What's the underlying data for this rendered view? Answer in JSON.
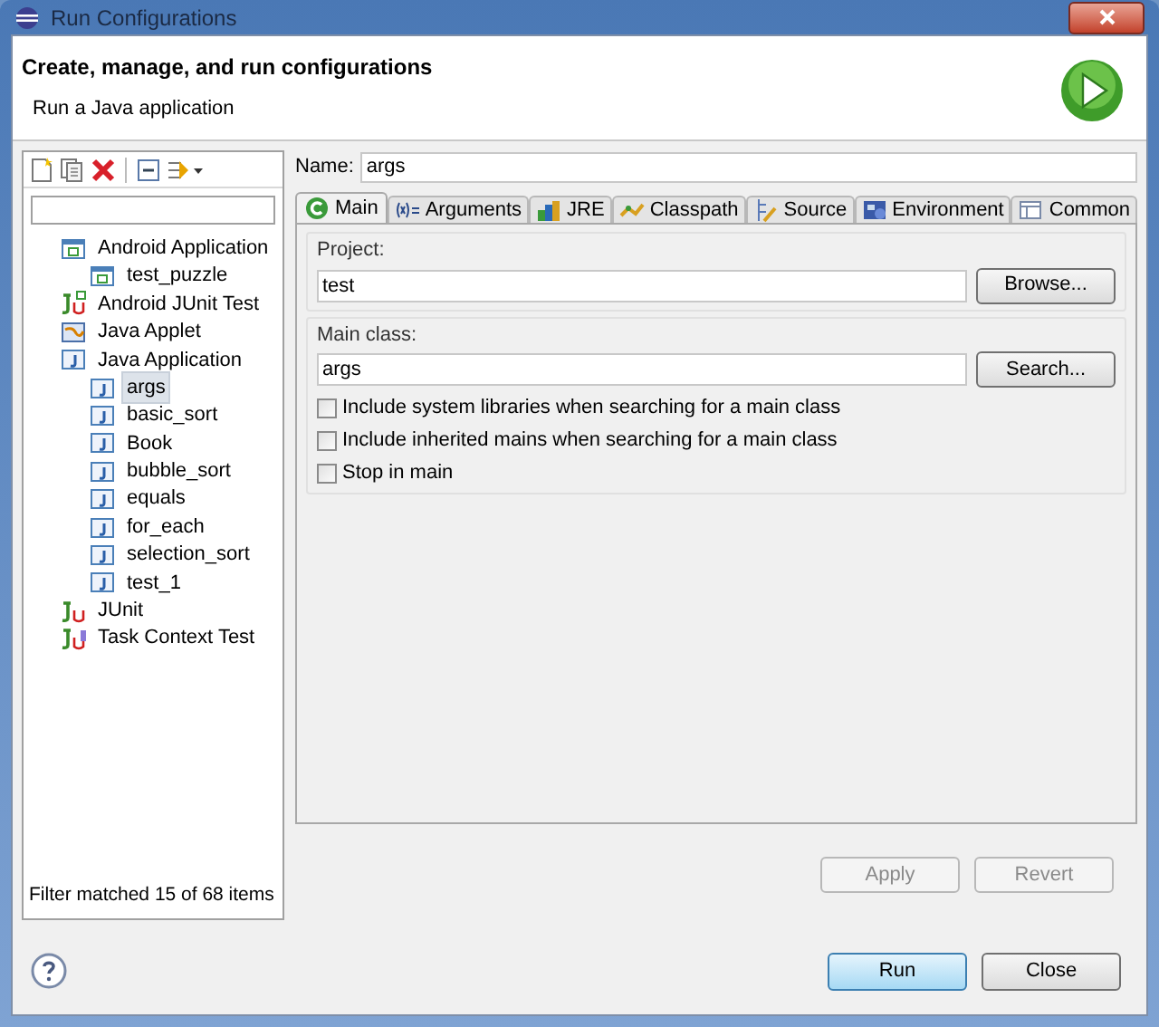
{
  "window": {
    "title": "Run Configurations"
  },
  "header": {
    "title": "Create, manage, and run configurations",
    "subtitle": "Run a Java application"
  },
  "tree": [
    {
      "label": "Android Application",
      "kind": "android",
      "selected": false,
      "children": [
        {
          "label": "test_puzzle",
          "kind": "android",
          "selected": false
        }
      ]
    },
    {
      "label": "Android JUnit Test",
      "kind": "android-junit",
      "selected": false
    },
    {
      "label": "Java Applet",
      "kind": "applet",
      "selected": false
    },
    {
      "label": "Java Application",
      "kind": "java",
      "selected": false,
      "children": [
        {
          "label": "args",
          "kind": "java",
          "selected": true
        },
        {
          "label": "basic_sort",
          "kind": "java",
          "selected": false
        },
        {
          "label": "Book",
          "kind": "java",
          "selected": false
        },
        {
          "label": "bubble_sort",
          "kind": "java",
          "selected": false
        },
        {
          "label": "equals",
          "kind": "java",
          "selected": false
        },
        {
          "label": "for_each",
          "kind": "java",
          "selected": false
        },
        {
          "label": "selection_sort",
          "kind": "java",
          "selected": false
        },
        {
          "label": "test_1",
          "kind": "java",
          "selected": false
        }
      ]
    },
    {
      "label": "JUnit",
      "kind": "junit",
      "selected": false
    },
    {
      "label": "Task Context Test",
      "kind": "task",
      "selected": false
    }
  ],
  "filter_status": "Filter matched 15 of 68 items",
  "name": {
    "label": "Name:",
    "value": "args"
  },
  "tabs": [
    {
      "label": "Main",
      "kind": "main",
      "selected": true
    },
    {
      "label": "Arguments",
      "kind": "args",
      "selected": false
    },
    {
      "label": "JRE",
      "kind": "jre",
      "selected": false
    },
    {
      "label": "Classpath",
      "kind": "classpath",
      "selected": false
    },
    {
      "label": "Source",
      "kind": "source",
      "selected": false
    },
    {
      "label": "Environment",
      "kind": "env",
      "selected": false
    },
    {
      "label": "Common",
      "kind": "common",
      "selected": false
    }
  ],
  "project": {
    "label": "Project:",
    "value": "test",
    "button": "Browse..."
  },
  "main_class": {
    "label": "Main class:",
    "value": "args",
    "button": "Search..."
  },
  "options": [
    {
      "label": "Include system libraries when searching for a main class",
      "checked": false
    },
    {
      "label": "Include inherited mains when searching for a main class",
      "checked": false
    },
    {
      "label": "Stop in main",
      "checked": false
    }
  ],
  "edit_buttons": [
    {
      "label": "Apply",
      "disabled": true
    },
    {
      "label": "Revert",
      "disabled": true
    }
  ],
  "dialog_buttons": [
    {
      "label": "Run",
      "default": true
    },
    {
      "label": "Close",
      "default": false
    }
  ]
}
